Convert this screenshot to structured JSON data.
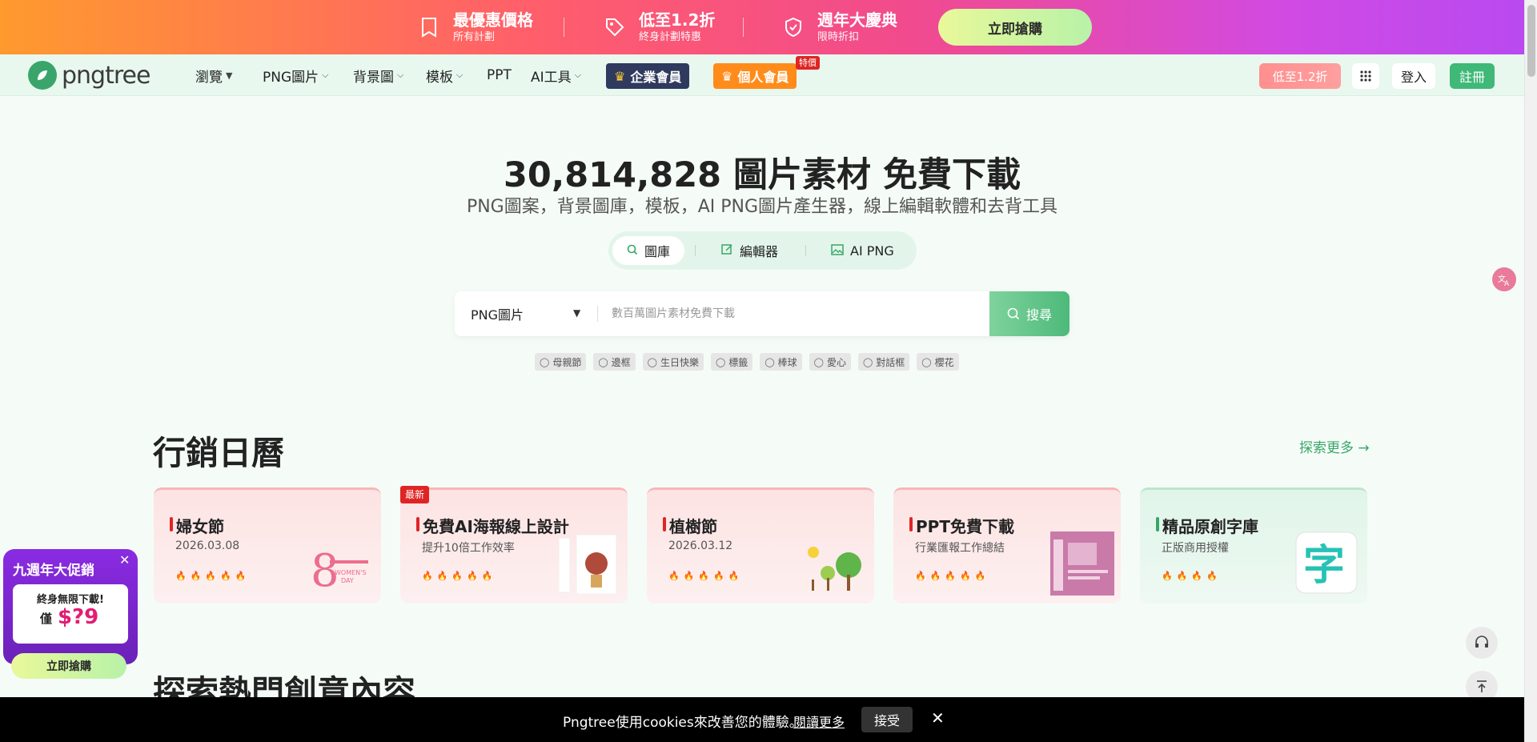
{
  "promo": {
    "items": [
      {
        "icon": "bookmark-icon",
        "title": "最優惠價格",
        "sub": "所有計劃"
      },
      {
        "icon": "tag-icon",
        "title": "低至1.2折",
        "sub": "終身計劃特惠"
      },
      {
        "icon": "shield-icon",
        "title": "週年大慶典",
        "sub": "限時折扣"
      }
    ],
    "cta": "立即搶購"
  },
  "nav": {
    "logo": "pngtree",
    "items": [
      {
        "label": "瀏覽"
      },
      {
        "label": "PNG圖片"
      },
      {
        "label": "背景圖"
      },
      {
        "label": "模板"
      },
      {
        "label": "PPT"
      },
      {
        "label": "AI工具"
      }
    ],
    "enterprise": "企業會員",
    "personal": "個人會員",
    "special_badge": "特價",
    "discount": "低至1.2折",
    "login": "登入",
    "register": "註冊"
  },
  "hero": {
    "title": "30,814,828 圖片素材 免費下載",
    "subtitle": "PNG圖案，背景圖庫，模板，AI PNG圖片產生器，線上編輯軟體和去背工具",
    "modes": [
      "圖庫",
      "編輯器",
      "AI PNG"
    ]
  },
  "search": {
    "category": "PNG圖片",
    "placeholder": "數百萬圖片素材免費下載",
    "button": "搜尋",
    "tags": [
      "母親節",
      "邊框",
      "生日快樂",
      "標籤",
      "棒球",
      "愛心",
      "對話框",
      "櫻花"
    ]
  },
  "marketing": {
    "title": "行銷日曆",
    "more": "探索更多 →",
    "new_badge": "最新",
    "cards": [
      {
        "title": "婦女節",
        "sub": "2026.03.08",
        "rating": 5
      },
      {
        "title": "免費AI海報線上設計",
        "sub": "提升10倍工作效率",
        "rating": 5
      },
      {
        "title": "植樹節",
        "sub": "2026.03.12",
        "rating": 5
      },
      {
        "title": "PPT免費下載",
        "sub": "行業匯報工作總結",
        "rating": 5
      },
      {
        "title": "精品原創字庫",
        "sub": "正版商用授權",
        "rating": 4
      }
    ]
  },
  "explore": {
    "title": "探索熱門創意內容"
  },
  "popup": {
    "title": "九週年大促銷",
    "line1": "終身無限下載!",
    "only": "僅",
    "price": "$?9",
    "button": "立即搶購"
  },
  "cookie": {
    "text": "Pngtree使用cookies來改善您的體驗。",
    "more": "閱讀更多",
    "accept": "接受"
  },
  "colors": {
    "brand": "#3aa56a",
    "accent_red": "#e02424",
    "popup": "#8a2be2"
  }
}
